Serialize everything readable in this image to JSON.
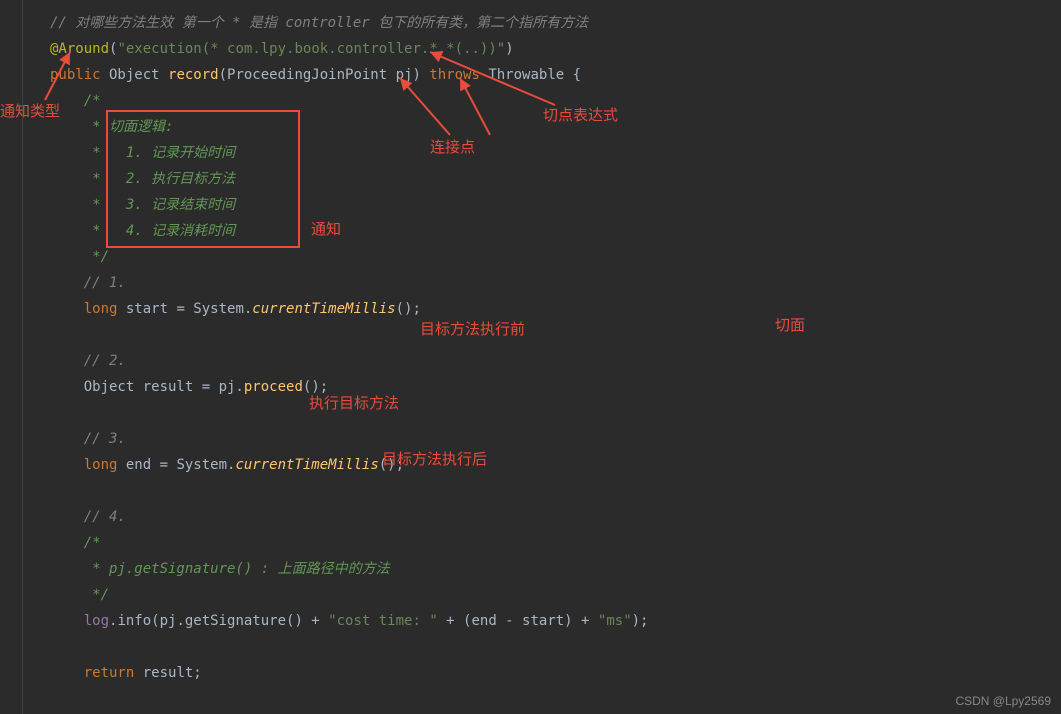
{
  "code": {
    "l1": "// 对哪些方法生效 第一个 * 是指 controller 包下的所有类，第二个指所有方法",
    "l2a": "@Around",
    "l2b": "(",
    "l2c": "\"execution(* com.lpy.book.controller.*.*(..))\"",
    "l2d": ")",
    "l3a": "public",
    "l3b": " Object ",
    "l3c": "record",
    "l3d": "(ProceedingJoinPoint pj) ",
    "l3e": "throws",
    "l3f": " Throwable {",
    "l4": "    /*",
    "l5": "     * 切面逻辑:",
    "l6": "     *   1. 记录开始时间",
    "l7": "     *   2. 执行目标方法",
    "l8": "     *   3. 记录结束时间",
    "l9": "     *   4. 记录消耗时间",
    "l10": "     */",
    "l11": "    // 1.",
    "l12a": "    ",
    "l12b": "long",
    "l12c": " start = System.",
    "l12d": "currentTimeMillis",
    "l12e": "();",
    "l13": "",
    "l14": "    // 2.",
    "l15a": "    Object result = pj.",
    "l15b": "proceed",
    "l15c": "();",
    "l16": "",
    "l17": "    // 3.",
    "l18a": "    ",
    "l18b": "long",
    "l18c": " end = System.",
    "l18d": "currentTimeMillis",
    "l18e": "();",
    "l19": "",
    "l20": "    // 4.",
    "l21": "    /*",
    "l22": "     * pj.getSignature() : 上面路径中的方法",
    "l23": "     */",
    "l24a": "    ",
    "l24b": "log",
    "l24c": ".info(pj.getSignature() + ",
    "l24d": "\"cost time: \"",
    "l24e": " + (end - start) + ",
    "l24f": "\"ms\"",
    "l24g": ");",
    "l25": "",
    "l26a": "    ",
    "l26b": "return",
    "l26c": " result;"
  },
  "labels": {
    "adviceType": "通知类型",
    "pointcutExpr": "切点表达式",
    "joinPoint": "连接点",
    "advice": "通知",
    "beforeTarget": "目标方法执行前",
    "executeTarget": "执行目标方法",
    "afterTarget": "目标方法执行后",
    "aspect": "切面"
  },
  "watermark": "CSDN @Lpy2569"
}
